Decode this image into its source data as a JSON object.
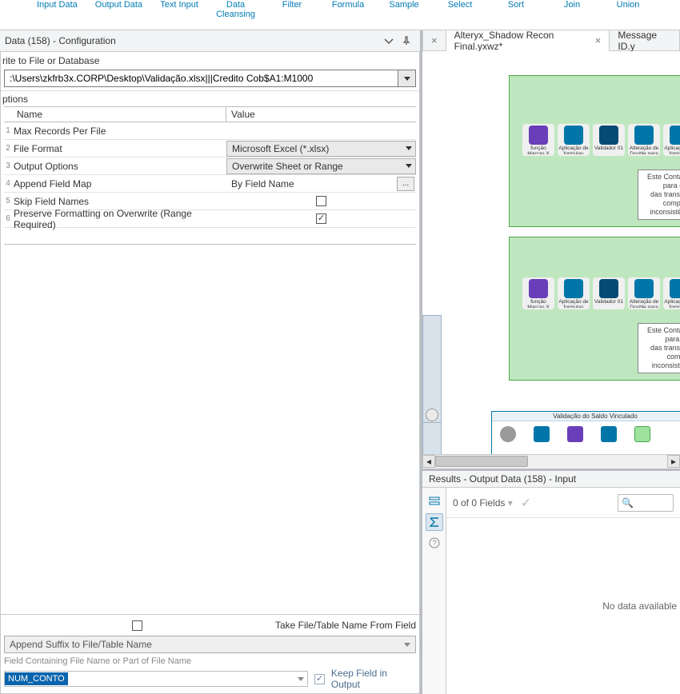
{
  "toolbar": {
    "items": [
      "",
      "Input Data",
      "Output Data",
      "Text Input",
      "Data\nCleansing",
      "Filter",
      "Formula",
      "Sample",
      "Select",
      "Sort",
      "Join",
      "Union"
    ]
  },
  "config": {
    "title": "Data (158) - Configuration",
    "write_label": "rite to File or Database",
    "path_value": ":\\Users\\zkfrb3x.CORP\\Desktop\\Validação.xlsx|||Credito Cob$A1:M1000",
    "options_label": "ptions",
    "columns": {
      "name": "Name",
      "value": "Value"
    },
    "rows": [
      {
        "n": "1",
        "name": "Max Records Per File",
        "type": "blank"
      },
      {
        "n": "2",
        "name": "File Format",
        "type": "select",
        "value": "Microsoft Excel (*.xlsx)"
      },
      {
        "n": "3",
        "name": "Output Options",
        "type": "select",
        "value": "Overwrite Sheet or Range"
      },
      {
        "n": "4",
        "name": "Append Field Map",
        "type": "ellipsis",
        "value": "By Field Name"
      },
      {
        "n": "5",
        "name": "Skip Field Names",
        "type": "check",
        "checked": false
      },
      {
        "n": "6",
        "name": "Preserve Formatting on Overwrite (Range Required)",
        "type": "check",
        "checked": true
      }
    ],
    "take_label": "Take File/Table Name From Field",
    "mode_value": "Append Suffix to File/Table Name",
    "field_hint": "Field Containing File Name or Part of File Name",
    "field_value": "NUM_CONTO",
    "keep_label": "Keep Field in Output"
  },
  "canvas": {
    "tabs": [
      {
        "label": "Alteryx_Shadow Recon Final.yxwz*",
        "active": true,
        "closable": true
      },
      {
        "label": "Message ID.y",
        "active": false,
        "closable": false
      }
    ],
    "close_left": "×",
    "container_note_lines": [
      "Este Container serve para criaçã",
      "das transações em comparaçã",
      "inconsistêntes para"
    ],
    "container2_note_lines": [
      "Este Container serve para criaç",
      "das transações em compara",
      "inconsistêntes par"
    ],
    "wf3_title": "Validação do Saldo Vinculado",
    "nodes_common": [
      {
        "label": "função Marcas X\nLSG",
        "cls": "ic-purple"
      },
      {
        "label": "Aplicação de\nformulas",
        "cls": "ic-blue"
      },
      {
        "label": "Validador 01",
        "cls": "ic-dkblue"
      },
      {
        "label": "Alteração de\nDouble para\nFixedDecimal",
        "cls": "ic-blue"
      },
      {
        "label": "Aplicação de\nformulas",
        "cls": "ic-blue"
      }
    ]
  },
  "results": {
    "title": "Results - Output Data (158) - Input",
    "field_count": "0 of 0 Fields",
    "nodata": "No data available"
  }
}
